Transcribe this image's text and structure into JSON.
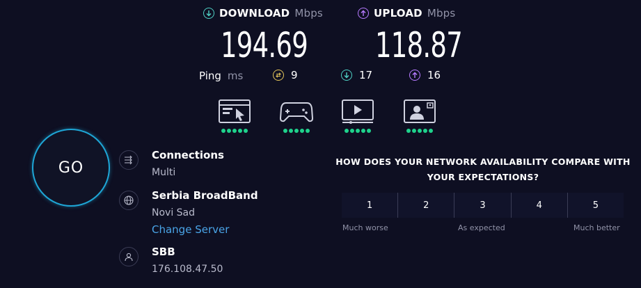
{
  "download": {
    "label": "DOWNLOAD",
    "unit": "Mbps",
    "value": "194.69",
    "icon": "download-arrow-icon",
    "color": "#4fd0c4"
  },
  "upload": {
    "label": "UPLOAD",
    "unit": "Mbps",
    "value": "118.87",
    "icon": "upload-arrow-icon",
    "color": "#b77bff"
  },
  "ping": {
    "label": "Ping",
    "unit": "ms",
    "idle": {
      "value": "9",
      "icon": "idle-latency-icon",
      "color": "#e3c45a"
    },
    "download": {
      "value": "17",
      "icon": "download-latency-icon",
      "color": "#4fd0c4"
    },
    "upload": {
      "value": "16",
      "icon": "upload-latency-icon",
      "color": "#b77bff"
    }
  },
  "activities": [
    {
      "icon": "web-browsing-icon",
      "rating": 5
    },
    {
      "icon": "gaming-icon",
      "rating": 5
    },
    {
      "icon": "video-streaming-icon",
      "rating": 5
    },
    {
      "icon": "video-chat-icon",
      "rating": 5
    }
  ],
  "go_button": {
    "label": "GO"
  },
  "connections": {
    "title": "Connections",
    "value": "Multi"
  },
  "server": {
    "name": "Serbia BroadBand",
    "location": "Novi Sad",
    "change_label": "Change Server"
  },
  "isp": {
    "name": "SBB",
    "ip": "176.108.47.50"
  },
  "survey": {
    "question_line1": "HOW DOES YOUR NETWORK AVAILABILITY COMPARE WITH",
    "question_line2": "YOUR EXPECTATIONS?",
    "options": [
      "1",
      "2",
      "3",
      "4",
      "5"
    ],
    "low_label": "Much worse",
    "mid_label": "As expected",
    "high_label": "Much better"
  },
  "colors": {
    "accent": "#1ea6d6",
    "link": "#4aa5e8",
    "good": "#1fd28c",
    "background": "#0e0f22"
  }
}
